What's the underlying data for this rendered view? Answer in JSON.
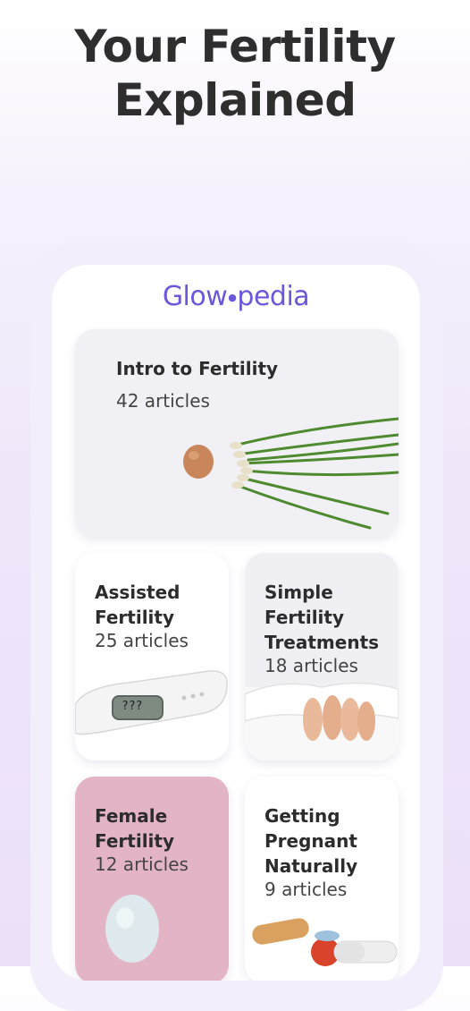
{
  "headline": {
    "line1": "Your Fertility",
    "line2": "Explained"
  },
  "logo": {
    "part1": "Glow",
    "part2": "pedia"
  },
  "cards": [
    {
      "title_lines": [
        "Intro to Fertility"
      ],
      "count": "42 articles"
    },
    {
      "title_lines": [
        "Assisted",
        "Fertility"
      ],
      "count": "25 articles"
    },
    {
      "title_lines": [
        "Simple",
        "Fertility",
        "Treatments"
      ],
      "count": "18 articles"
    },
    {
      "title_lines": [
        "Female",
        "Fertility"
      ],
      "count": "12 articles"
    },
    {
      "title_lines": [
        "Getting",
        "Pregnant",
        "Naturally"
      ],
      "count": "9 articles"
    }
  ],
  "illustrations": {
    "test_display": "???"
  },
  "colors": {
    "brand": "#6a57d9",
    "pink_card": "#e3b4c6",
    "background": "#efe6fa"
  }
}
